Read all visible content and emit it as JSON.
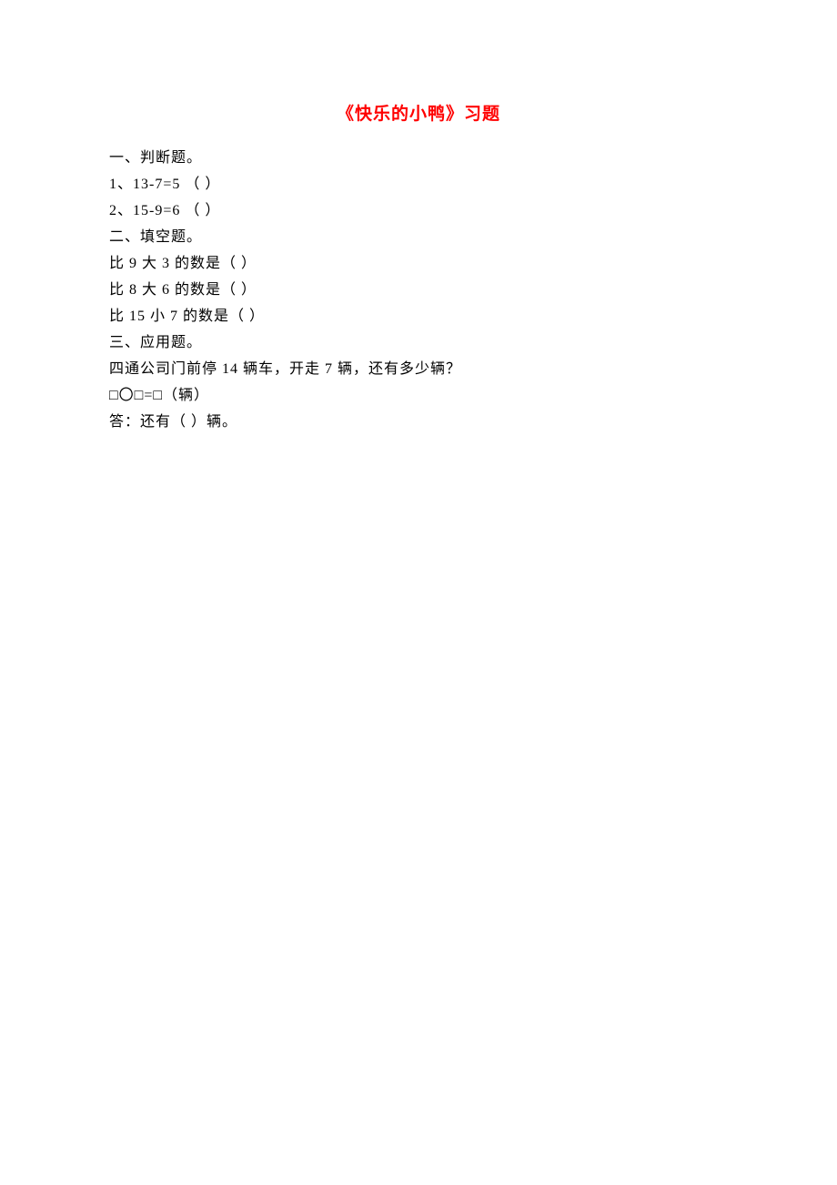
{
  "title": "《快乐的小鸭》习题",
  "section1": {
    "heading": "一、判断题。",
    "q1": "1、13-7=5   （  ）",
    "q2": "2、15-9=6   （  ）"
  },
  "section2": {
    "heading": "二、填空题。",
    "q1": "比 9 大 3 的数是（  ）",
    "q2": "比 8 大 6 的数是（  ）",
    "q3": "比 15 小 7 的数是（  ）"
  },
  "section3": {
    "heading": "三、应用题。",
    "q1": "四通公司门前停 14 辆车，开走 7 辆，还有多少辆？",
    "expr": "□〇□=□（辆）",
    "answer": "答：还有（   ）辆。"
  }
}
